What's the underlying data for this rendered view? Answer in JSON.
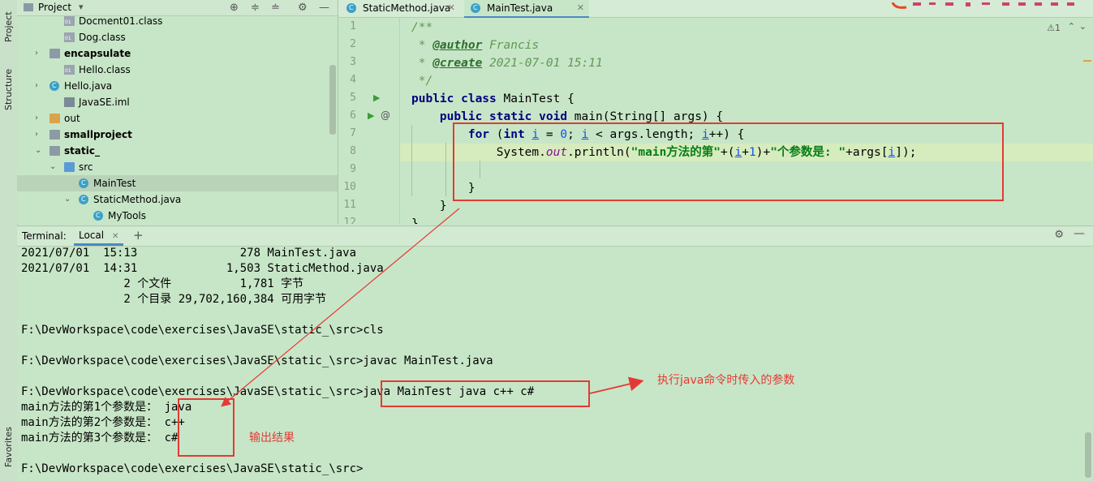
{
  "left_strip": {
    "project_tab": "Project",
    "structure_tab": "Structure",
    "favorites_tab": "Favorites"
  },
  "project_panel": {
    "title": "Project",
    "tree": [
      {
        "label": "Docment01.class",
        "type": "class",
        "indent": 2,
        "bold": false,
        "arrow": ""
      },
      {
        "label": "Dog.class",
        "type": "class",
        "indent": 2,
        "bold": false,
        "arrow": ""
      },
      {
        "label": "encapsulate",
        "type": "folder",
        "indent": 1,
        "bold": true,
        "arrow": "›"
      },
      {
        "label": "Hello.class",
        "type": "class",
        "indent": 2,
        "bold": false,
        "arrow": ""
      },
      {
        "label": "Hello.java",
        "type": "java",
        "indent": 1,
        "bold": false,
        "arrow": "›"
      },
      {
        "label": "JavaSE.iml",
        "type": "iml",
        "indent": 2,
        "bold": false,
        "arrow": ""
      },
      {
        "label": "out",
        "type": "folder-out",
        "indent": 1,
        "bold": false,
        "arrow": "›"
      },
      {
        "label": "smallproject",
        "type": "folder",
        "indent": 1,
        "bold": true,
        "arrow": "›"
      },
      {
        "label": "static_",
        "type": "folder",
        "indent": 1,
        "bold": true,
        "arrow": "⌄"
      },
      {
        "label": "src",
        "type": "folder-src",
        "indent": 2,
        "bold": false,
        "arrow": "⌄"
      },
      {
        "label": "MainTest",
        "type": "java",
        "indent": 3,
        "bold": false,
        "arrow": "",
        "selected": true
      },
      {
        "label": "StaticMethod.java",
        "type": "java",
        "indent": 3,
        "bold": false,
        "arrow": "⌄"
      },
      {
        "label": "MyTools",
        "type": "java",
        "indent": 4,
        "bold": false,
        "arrow": ""
      }
    ]
  },
  "editor_tabs": [
    {
      "label": "StaticMethod.java",
      "active": false
    },
    {
      "label": "MainTest.java",
      "active": true
    }
  ],
  "editor": {
    "warning": "⚠1",
    "line_numbers": [
      "1",
      "2",
      "3",
      "4",
      "5",
      "6",
      "7",
      "8",
      "9",
      "10",
      "11",
      "12"
    ]
  },
  "terminal": {
    "title": "Terminal:",
    "tab": "Local",
    "lines": [
      "2021/07/01  15:13               278 MainTest.java",
      "2021/07/01  14:31             1,503 StaticMethod.java",
      "               2 个文件          1,781 字节",
      "               2 个目录 29,702,160,384 可用字节",
      "",
      "F:\\DevWorkspace\\code\\exercises\\JavaSE\\static_\\src>cls",
      "",
      "F:\\DevWorkspace\\code\\exercises\\JavaSE\\static_\\src>javac MainTest.java",
      "",
      "F:\\DevWorkspace\\code\\exercises\\JavaSE\\static_\\src>java MainTest java c++ c#",
      "main方法的第1个参数是： java",
      "main方法的第2个参数是： c++",
      "main方法的第3个参数是： c#",
      "",
      "F:\\DevWorkspace\\code\\exercises\\JavaSE\\static_\\src>"
    ]
  },
  "annotations": {
    "command_label": "执行java命令时传入的参数",
    "output_label": "输出结果",
    "color": "#e53935"
  },
  "colors": {
    "background": "#c7e6c7",
    "accent": "#4a88c7"
  }
}
